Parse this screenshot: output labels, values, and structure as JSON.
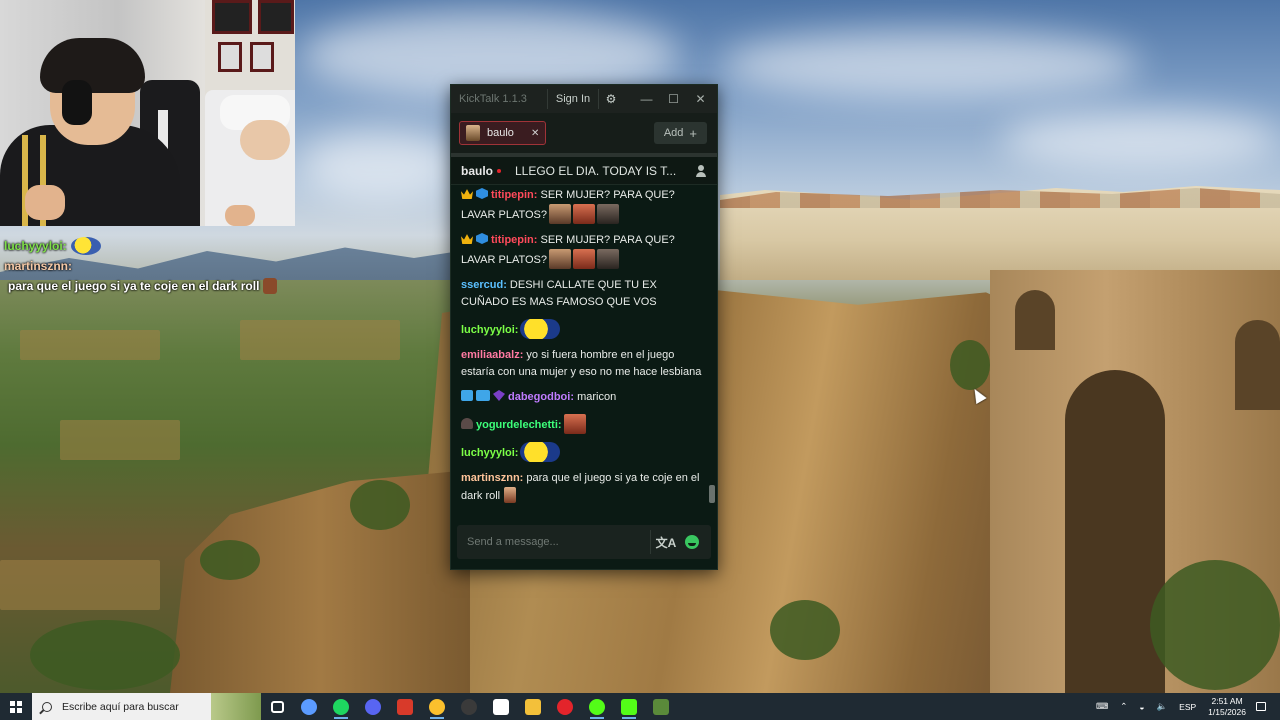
{
  "stream_overlay": {
    "lines": [
      {
        "user": "luchyyyloi:",
        "message": "",
        "emote": "blob-emote"
      },
      {
        "user": "martinsznn:",
        "message": "para que el juego si ya te coje en el dark roll",
        "emote": "face-emote"
      }
    ]
  },
  "kicktalk": {
    "app_title": "KickTalk 1.1.3",
    "sign_in_label": "Sign In",
    "tab": {
      "label": "baulo",
      "close_glyph": "✕"
    },
    "add_label": "Add",
    "stream_info": {
      "user": "baulo",
      "title": "LLEGO EL DIA. TODAY IS T..."
    },
    "messages": [
      {
        "badges": [
          "crown",
          "cube"
        ],
        "user": "titipepin:",
        "color": "#ff4a5b",
        "text": "SER MUJER? PARA QUE? LAVAR PLATOS?",
        "emotes": [
          "face",
          "red",
          "dark"
        ],
        "clipped": true
      },
      {
        "badges": [
          "crown",
          "cube"
        ],
        "user": "titipepin:",
        "color": "#ff4a5b",
        "text": "SER MUJER? PARA QUE? LAVAR PLATOS?",
        "emotes": [
          "face",
          "red",
          "dark"
        ]
      },
      {
        "badges": [],
        "user": "ssercud:",
        "color": "#5bc0ff",
        "text": "DESHI CALLATE QUE TU EX CUÑADO ES MAS FAMOSO QUE VOS",
        "emotes": []
      },
      {
        "badges": [],
        "user": "luchyyyloi:",
        "color": "#7cff47",
        "text": "",
        "emotes": [
          "blob"
        ]
      },
      {
        "badges": [],
        "user": "emiliaabalz:",
        "color": "#ff7aa2",
        "text": "yo si fuera hombre en el juego estaría con una mujer y eso no me hace lesbiana",
        "emotes": []
      },
      {
        "badges": [
          "tool",
          "num",
          "gem"
        ],
        "user": "dabegodboi:",
        "color": "#c07cff",
        "text": "maricon",
        "emotes": []
      },
      {
        "badges": [
          "ghost"
        ],
        "user": "yogurdelechetti:",
        "color": "#3dff7a",
        "text": "",
        "emotes": [
          "red"
        ]
      },
      {
        "badges": [],
        "user": "luchyyyloi:",
        "color": "#7cff47",
        "text": "",
        "emotes": [
          "blob"
        ]
      },
      {
        "badges": [],
        "user": "martinsznn:",
        "color": "#ffc49a",
        "text": "para que el juego si ya te coje en el dark roll",
        "emotes": [
          "mini"
        ]
      }
    ],
    "input_placeholder": "Send a message...",
    "translate_glyph": "文A"
  },
  "taskbar": {
    "search_placeholder": "Escribe aquí para buscar",
    "apps": [
      {
        "name": "task-view-icon",
        "color": "#ffffff"
      },
      {
        "name": "copilot-icon",
        "color": "#5b9bff"
      },
      {
        "name": "spotify-icon",
        "color": "#1ed760"
      },
      {
        "name": "discord-icon",
        "color": "#5865f2"
      },
      {
        "name": "voicemeeter-icon",
        "color": "#d83a2a"
      },
      {
        "name": "chrome-icon",
        "color": "#fbc02d"
      },
      {
        "name": "obs-icon",
        "color": "#3a3a3a"
      },
      {
        "name": "streamdeck-icon",
        "color": "#ffffff"
      },
      {
        "name": "file-explorer-icon",
        "color": "#f3c03a"
      },
      {
        "name": "opera-icon",
        "color": "#e3242b"
      },
      {
        "name": "kick-app-icon",
        "color": "#53fc18"
      },
      {
        "name": "kicktalk-icon",
        "color": "#53fc18"
      },
      {
        "name": "terminal-icon",
        "color": "#5a8a3a"
      }
    ],
    "language": "ESP",
    "time": "2:51 AM",
    "date": "1/15/2026"
  }
}
